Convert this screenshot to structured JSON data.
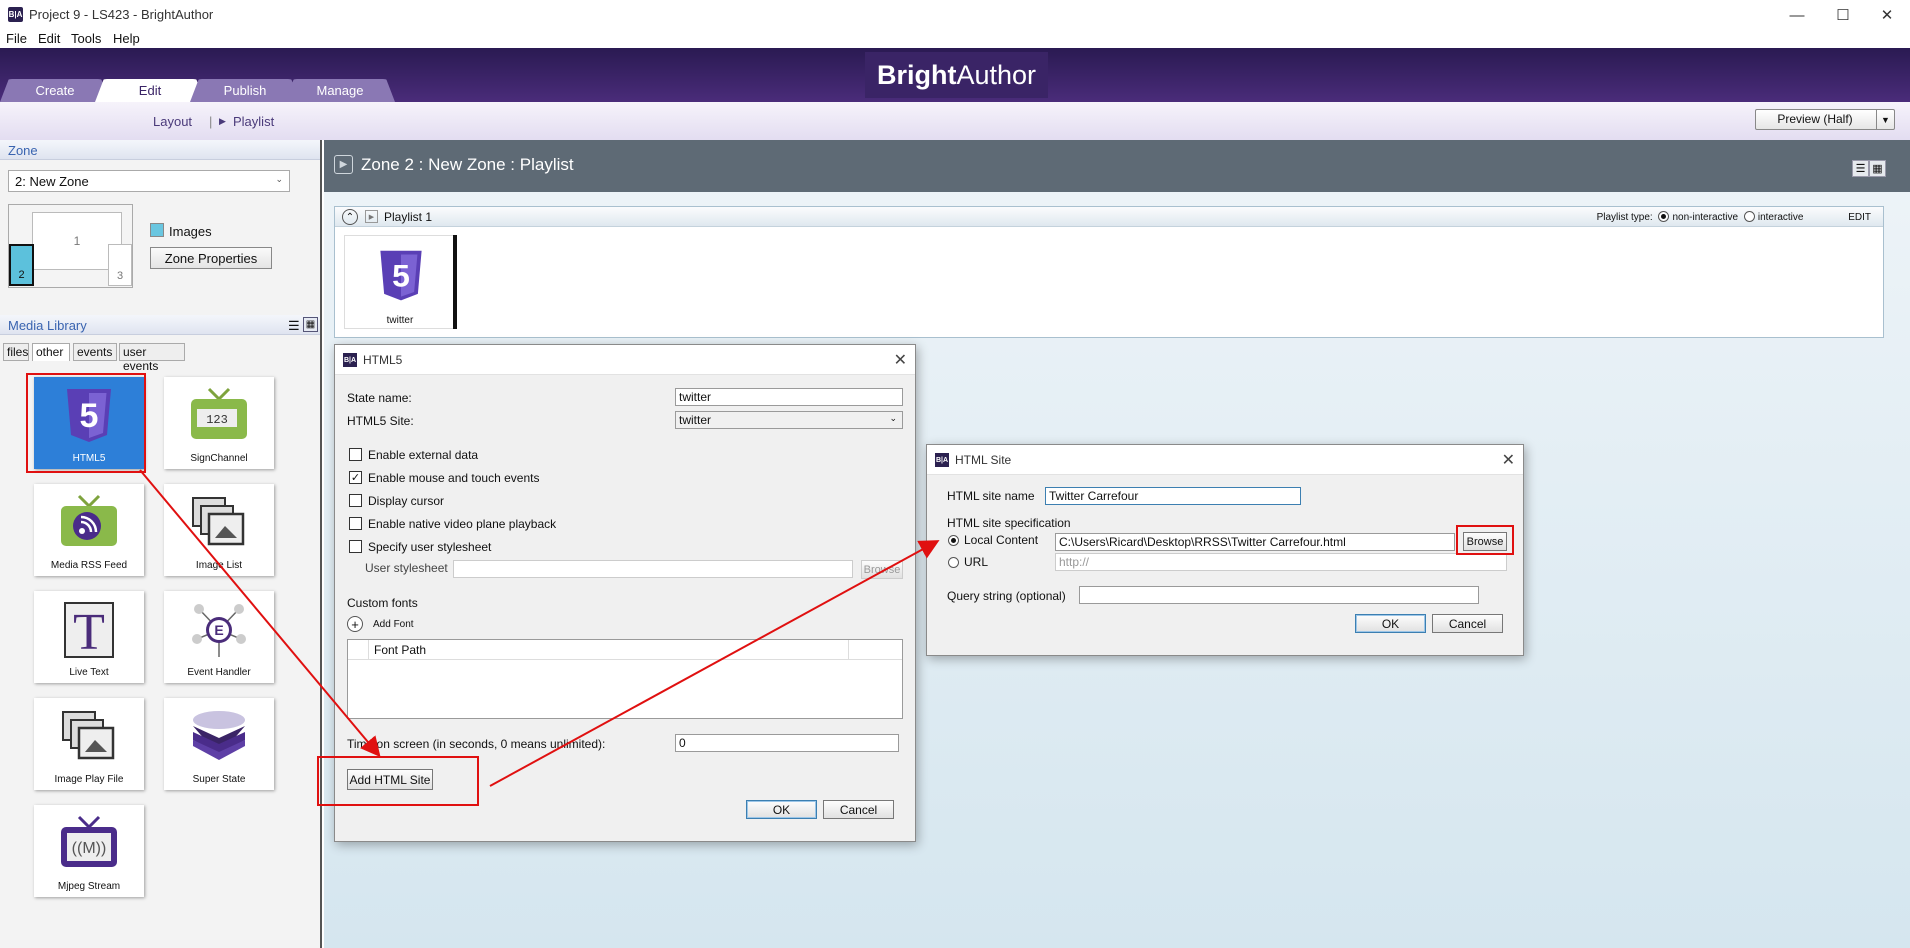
{
  "window": {
    "title": "Project 9 - LS423 - BrightAuthor",
    "app_icon": "B|A"
  },
  "menu": [
    "File",
    "Edit",
    "Tools",
    "Help"
  ],
  "brand": {
    "bold": "Bright",
    "light": "Author"
  },
  "tabs": [
    "Create",
    "Edit",
    "Publish",
    "Manage"
  ],
  "active_tab": "Edit",
  "subnav": {
    "layout": "Layout",
    "playlist": "Playlist"
  },
  "preview": {
    "label": "Preview (Half)"
  },
  "zone_panel": {
    "header": "Zone",
    "selected": "2: New Zone",
    "zones": [
      "1",
      "2",
      "3"
    ],
    "images_label": "Images",
    "properties_button": "Zone Properties"
  },
  "media_library": {
    "header": "Media Library",
    "tabs": [
      "files",
      "other",
      "events",
      "user events"
    ],
    "selected_tab": "other",
    "items": [
      {
        "label": "HTML5",
        "icon": "html5-icon",
        "selected": true
      },
      {
        "label": "SignChannel",
        "icon": "signchannel-icon"
      },
      {
        "label": "Media RSS Feed",
        "icon": "rss-tv-icon"
      },
      {
        "label": "Image List",
        "icon": "image-list-icon"
      },
      {
        "label": "Live Text",
        "icon": "live-text-icon"
      },
      {
        "label": "Event Handler",
        "icon": "event-handler-icon"
      },
      {
        "label": "Image Play File",
        "icon": "image-play-file-icon"
      },
      {
        "label": "Super State",
        "icon": "super-state-icon"
      },
      {
        "label": "Mjpeg Stream",
        "icon": "mjpeg-stream-icon"
      }
    ]
  },
  "zone_header": {
    "title": "Zone 2 : New Zone :  Playlist"
  },
  "playlist": {
    "name": "Playlist 1",
    "type_label": "Playlist type:",
    "option_noninteractive": "non-interactive",
    "option_interactive": "interactive",
    "selected_type": "non-interactive",
    "edit_label": "EDIT",
    "item_label": "twitter"
  },
  "html5_dialog": {
    "title": "HTML5",
    "state_name_label": "State name:",
    "state_name_value": "twitter",
    "site_label": "HTML5 Site:",
    "site_value": "twitter",
    "checkboxes": [
      {
        "label": "Enable external data",
        "checked": false
      },
      {
        "label": "Enable mouse and touch events",
        "checked": true
      },
      {
        "label": "Display cursor",
        "checked": false
      },
      {
        "label": "Enable native video plane playback",
        "checked": false
      },
      {
        "label": "Specify user stylesheet",
        "checked": false
      }
    ],
    "user_stylesheet_label": "User stylesheet",
    "browse_label": "Browse",
    "custom_fonts_label": "Custom fonts",
    "add_font_label": "Add Font",
    "font_path_header": "Font Path",
    "time_label": "Time on screen (in seconds, 0 means unlimited):",
    "time_value": "0",
    "add_site_button": "Add HTML Site",
    "ok": "OK",
    "cancel": "Cancel"
  },
  "site_dialog": {
    "title": "HTML Site",
    "name_label": "HTML site name",
    "name_value": "Twitter Carrefour",
    "spec_label": "HTML site specification",
    "local_label": "Local Content",
    "local_value": "C:\\Users\\Ricard\\Desktop\\RRSS\\Twitter Carrefour.html",
    "browse_label": "Browse",
    "url_label": "URL",
    "url_placeholder": "http://",
    "query_label": "Query string (optional)",
    "query_value": "",
    "selected_spec": "Local Content",
    "ok": "OK",
    "cancel": "Cancel"
  },
  "colors": {
    "brand_purple": "#3a2466",
    "highlight_red": "#e01010",
    "selection_blue": "#2d7fd8"
  }
}
